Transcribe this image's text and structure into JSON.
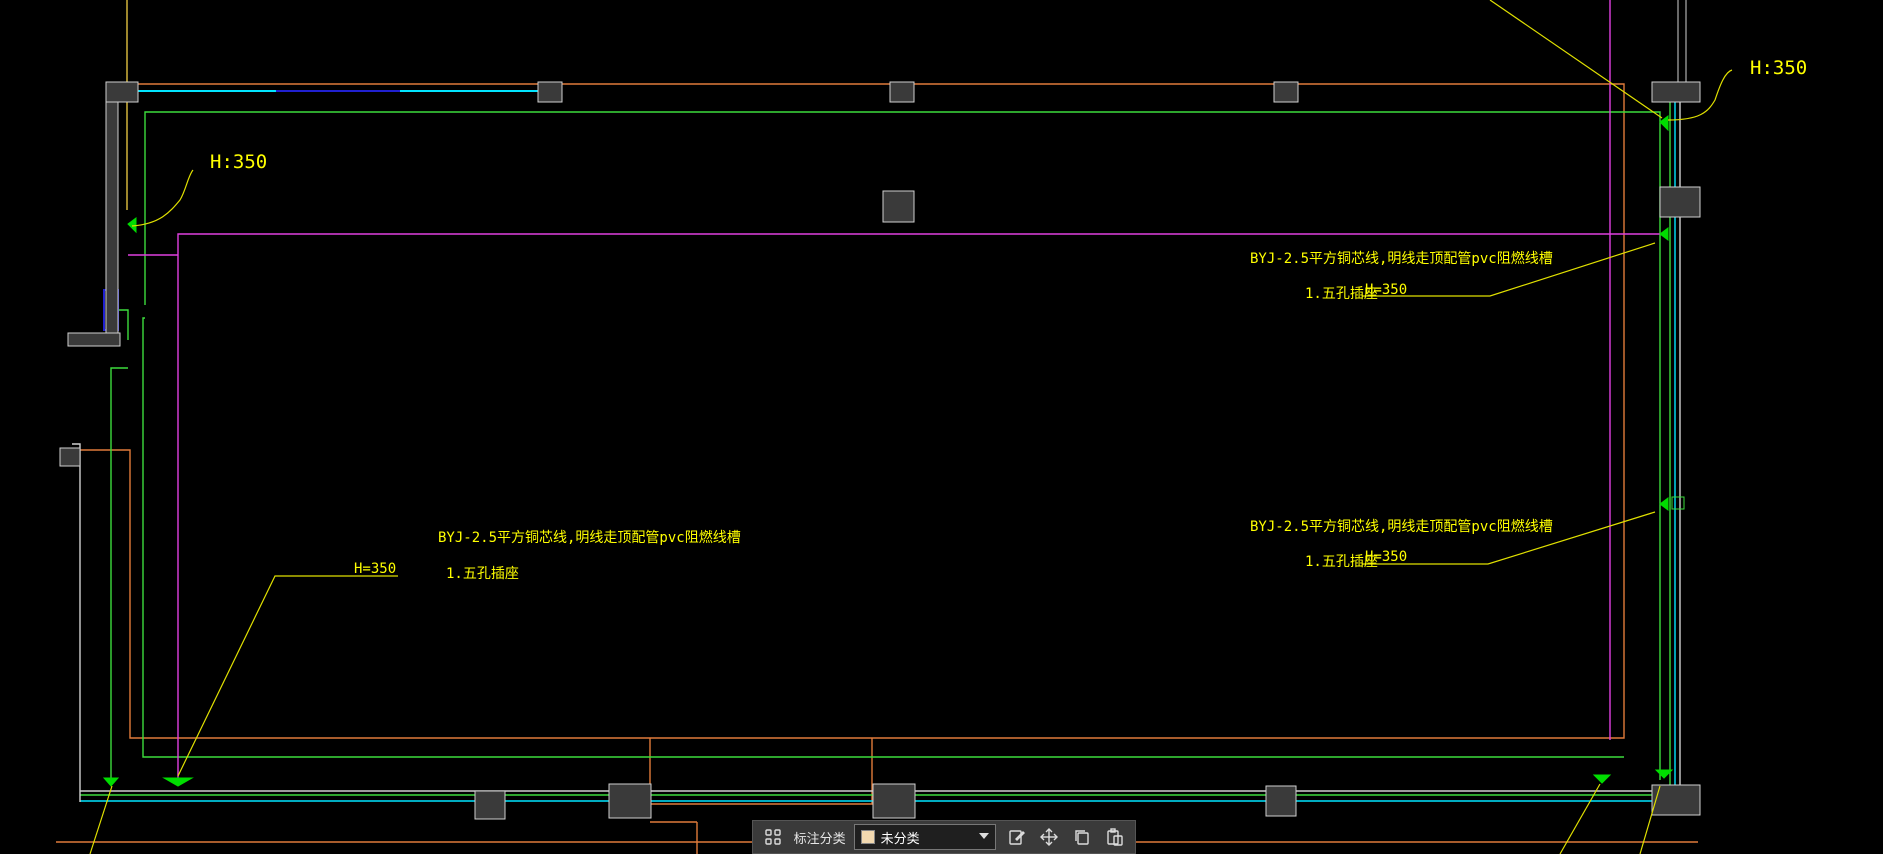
{
  "drawing": {
    "annotations": {
      "h_top_right": "H:350",
      "h_top_left": "H:350",
      "note_wire_right_1": "BYJ-2.5平方铜芯线,明线走顶配管pvc阻燃线槽",
      "note_socket_right_1": "1.五孔插座",
      "h_right_1": "H=350",
      "note_wire_right_2": "BYJ-2.5平方铜芯线,明线走顶配管pvc阻燃线槽",
      "note_socket_right_2": "1.五孔插座",
      "h_right_2": "H=350",
      "note_wire_left": "BYJ-2.5平方铜芯线,明线走顶配管pvc阻燃线槽",
      "note_socket_left": "1.五孔插座",
      "h_left": "H=350"
    },
    "colors": {
      "background": "#000000",
      "orange": "#e07a3a",
      "green": "#3cdc3c",
      "magenta": "#e040e0",
      "cyan": "#00e5ff",
      "yellow": "#ffff00",
      "blue": "#2020d0",
      "wall_fill": "#3a3a3a",
      "white": "#cfcfcf"
    }
  },
  "toolbar": {
    "category_label": "标注分类",
    "category_value": "未分类",
    "icons": [
      "grid-icon",
      "edit-icon",
      "move-icon",
      "copy-icon",
      "paste-icon"
    ]
  }
}
